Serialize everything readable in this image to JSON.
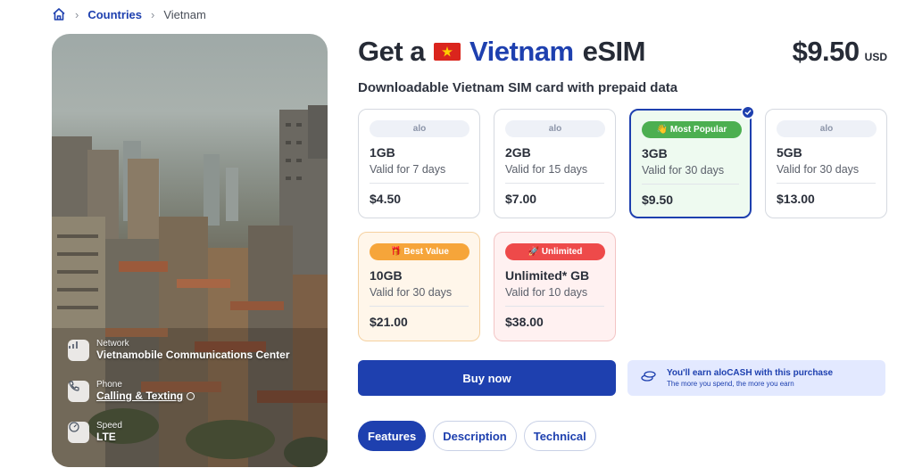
{
  "breadcrumb": {
    "home_icon": "home-icon",
    "countries_label": "Countries",
    "current_label": "Vietnam"
  },
  "hero": {
    "network_label": "Network",
    "network_value": "Vietnamobile Communications Center",
    "phone_label": "Phone",
    "phone_value": "Calling & Texting",
    "speed_label": "Speed",
    "speed_value": "LTE"
  },
  "header": {
    "title_prefix": "Get a",
    "country": "Vietnam",
    "title_suffix": "eSIM",
    "price": "$9.50",
    "currency": "USD",
    "subtitle": "Downloadable Vietnam SIM card with prepaid data"
  },
  "plans": [
    {
      "tag": "alo",
      "data": "1GB",
      "validity": "Valid for 7 days",
      "price": "$4.50"
    },
    {
      "tag": "alo",
      "data": "2GB",
      "validity": "Valid for 15 days",
      "price": "$7.00"
    },
    {
      "tag": "👋 Most Popular",
      "data": "3GB",
      "validity": "Valid for 30 days",
      "price": "$9.50"
    },
    {
      "tag": "alo",
      "data": "5GB",
      "validity": "Valid for 30 days",
      "price": "$13.00"
    },
    {
      "tag": "🎁 Best Value",
      "data": "10GB",
      "validity": "Valid for 30 days",
      "price": "$21.00"
    },
    {
      "tag": "🚀 Unlimited",
      "data": "Unlimited* GB",
      "validity": "Valid for 10 days",
      "price": "$38.00"
    }
  ],
  "actions": {
    "buy_label": "Buy now",
    "earn_title": "You'll earn aloCASH with this purchase",
    "earn_sub": "The more you spend, the more you earn"
  },
  "tabs": [
    {
      "label": "Features"
    },
    {
      "label": "Description"
    },
    {
      "label": "Technical"
    }
  ],
  "colors": {
    "accent": "#1e40af",
    "popular": "#4caf50",
    "best": "#f6a53a",
    "unlimited": "#ee4a4a"
  }
}
